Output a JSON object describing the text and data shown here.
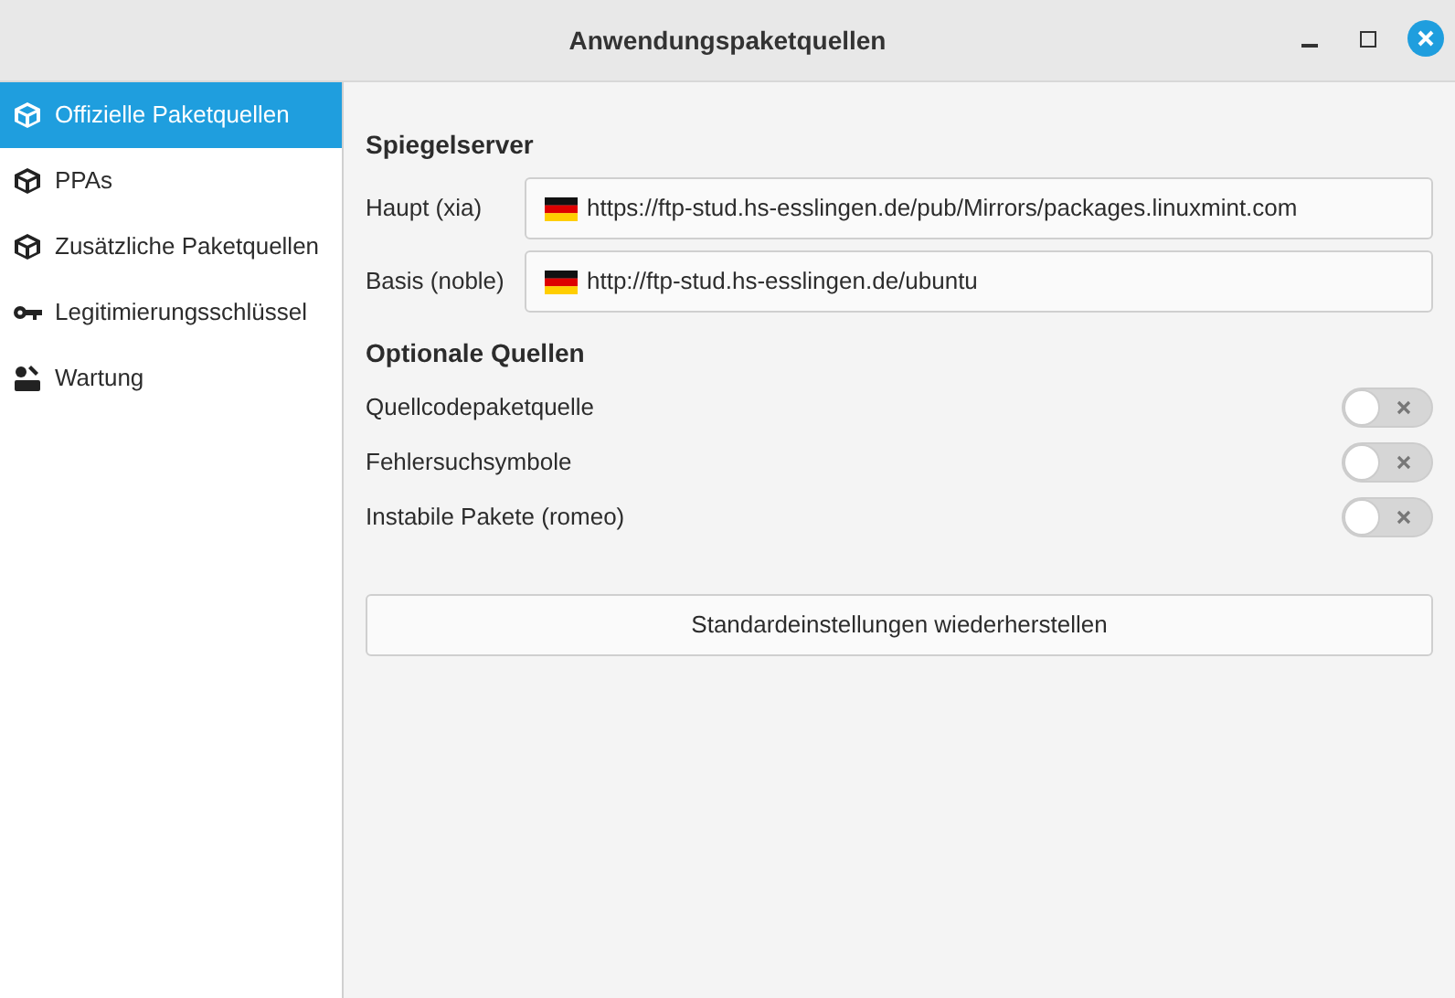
{
  "window": {
    "title": "Anwendungspaketquellen"
  },
  "sidebar": {
    "items": [
      {
        "label": "Offizielle Paketquellen",
        "kind": "package",
        "selected": true
      },
      {
        "label": "PPAs",
        "kind": "package",
        "selected": false
      },
      {
        "label": "Zusätzliche Paketquellen",
        "kind": "package",
        "selected": false
      },
      {
        "label": "Legitimierungsschlüssel",
        "kind": "key",
        "selected": false
      },
      {
        "label": "Wartung",
        "kind": "tools",
        "selected": false
      }
    ]
  },
  "mirrors": {
    "heading": "Spiegelserver",
    "rows": [
      {
        "label": "Haupt (xia)",
        "value": "https://ftp-stud.hs-esslingen.de/pub/Mirrors/packages.linuxmint.com"
      },
      {
        "label": "Basis (noble)",
        "value": "http://ftp-stud.hs-esslingen.de/ubuntu"
      }
    ]
  },
  "optional": {
    "heading": "Optionale Quellen",
    "rows": [
      {
        "label": "Quellcodepaketquelle",
        "on": false
      },
      {
        "label": "Fehlersuchsymbole",
        "on": false
      },
      {
        "label": "Instabile Pakete (romeo)",
        "on": false
      }
    ]
  },
  "reset_button": "Standardeinstellungen wiederherstellen"
}
